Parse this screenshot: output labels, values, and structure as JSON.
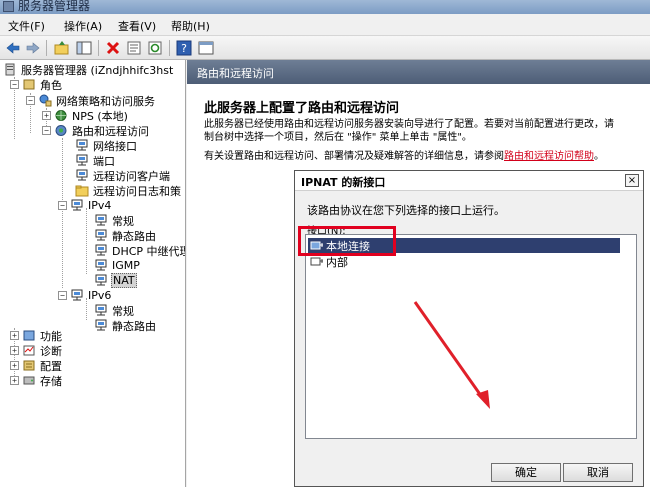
{
  "window": {
    "title": "服务器管理器"
  },
  "menu": [
    "文件(F)",
    "操作(A)",
    "查看(V)",
    "帮助(H)"
  ],
  "tree": {
    "root": "服务器管理器 (iZndjhhifc3hst",
    "roles": "角色",
    "npas": "网络策略和访问服务",
    "nps": "NPS (本地)",
    "rras": "路由和远程访问",
    "items": [
      "网络接口",
      "端口",
      "远程访问客户端",
      "远程访问日志和策"
    ],
    "ipv4": "IPv4",
    "ipv4_items": [
      "常规",
      "静态路由",
      "DHCP 中继代理",
      "IGMP",
      "NAT"
    ],
    "ipv6": "IPv6",
    "ipv6_items": [
      "常规",
      "静态路由"
    ],
    "bottom": [
      "功能",
      "诊断",
      "配置",
      "存储"
    ]
  },
  "content": {
    "header": "路由和远程访问",
    "heading": "此服务器上配置了路由和远程访问",
    "para1_line1": "此服务器已经使用路由和远程访问服务器安装向导进行了配置。若要对当前配置进行更改，请",
    "para1_line2": "制台树中选择一个项目，然后在 \"操作\" 菜单上单击 \"属性\"。",
    "para2": "有关设置路由和远程访问、部署情况及疑难解答的详细信息，请参阅",
    "para2_link": "路由和远程访问帮助",
    "para2_end": "。"
  },
  "dialog": {
    "title": "IPNAT 的新接口",
    "close": "×",
    "description": "该路由协议在您下列选择的接口上运行。",
    "list_label": "接口(N):",
    "interfaces": [
      "本地连接",
      "内部"
    ],
    "ok": "确定",
    "cancel": "取消"
  },
  "colors": {
    "highlight_box": "#e1001f",
    "arrow": "#e0202a",
    "selection": "#2e3f6f"
  }
}
